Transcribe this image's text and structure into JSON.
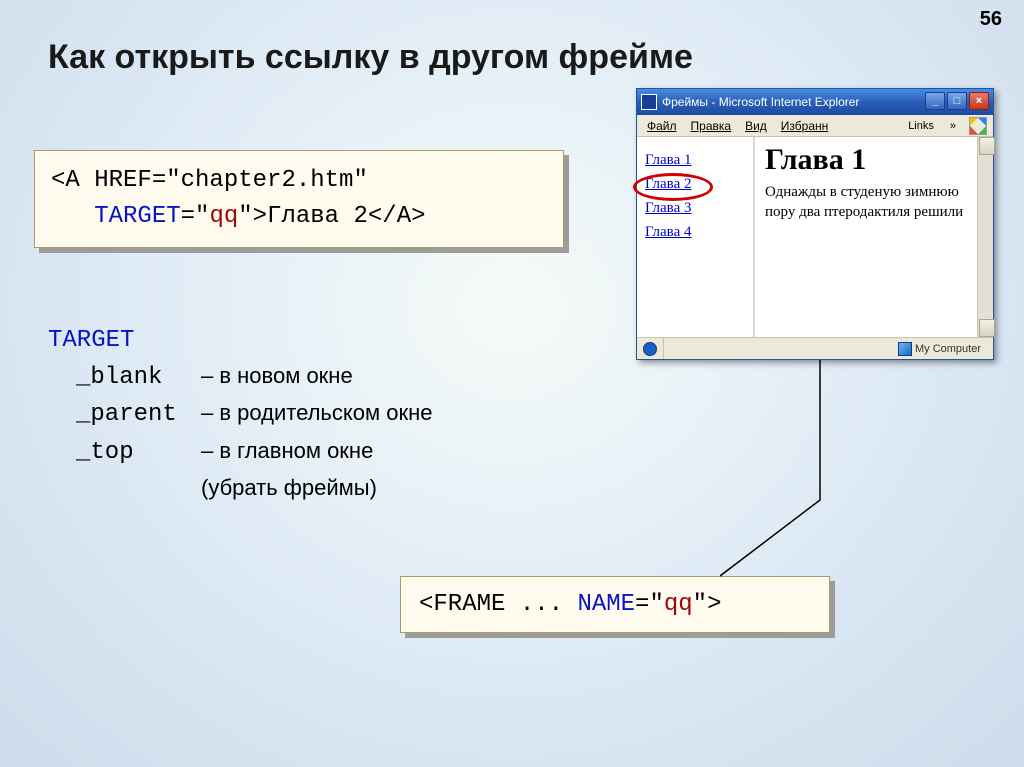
{
  "page_number": "56",
  "title": "Как открыть ссылку в другом фрейме",
  "code1": {
    "t1": "<A HREF=\"chapter2.htm\"",
    "t2_pre": "   ",
    "t2_kw": "TARGET",
    "t2_eq": "=\"",
    "t2_val": "qq",
    "t2_post": "\">Глава 2</A>"
  },
  "target_header": "TARGET",
  "targets": [
    {
      "kw": "_blank",
      "desc": "– в новом окне"
    },
    {
      "kw": "_parent",
      "desc": "– в родительском окне"
    },
    {
      "kw": "_top",
      "desc": "– в главном окне"
    }
  ],
  "target_extra": "(убрать фреймы)",
  "code2": {
    "pre": "<FRAME ... ",
    "kw": "NAME",
    "eq": "=\"",
    "val": "qq",
    "post": "\">"
  },
  "browser": {
    "title": "Фреймы - Microsoft Internet Explorer",
    "menu": [
      "Файл",
      "Правка",
      "Вид",
      "Избранн"
    ],
    "links_label": "Links",
    "left_links": [
      "Глава 1",
      "Глава 2",
      "Глава 3",
      "Глава 4"
    ],
    "right_heading": "Глава 1",
    "right_text": "Однажды в студеную зимнюю пору два птеродактиля решили",
    "status_right": "My Computer"
  }
}
